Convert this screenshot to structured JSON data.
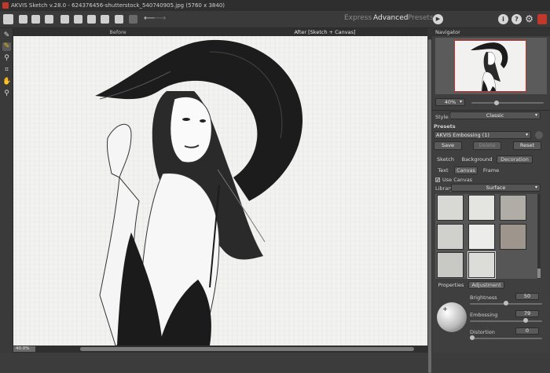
{
  "window": {
    "title": "AKVIS Sketch v.28.0 - 624376456-shutterstock_540740905.jpg (5760 x 3840)"
  },
  "toolbar": {
    "modes": [
      "Express",
      "Advanced",
      "Presets"
    ],
    "active_mode": "Advanced",
    "icons": [
      "home-icon",
      "open-icon",
      "save-icon",
      "print-icon",
      "batch-icon",
      "plugin-icon",
      "share-icon",
      "settings-icon",
      "apply-icon",
      "undo-icon",
      "redo-icon"
    ],
    "right_icons": [
      "info-icon",
      "help-icon",
      "gear-icon",
      "bookmark-icon"
    ]
  },
  "tools": [
    "pencil-icon",
    "eraser-icon",
    "stamp-icon",
    "crop-icon",
    "hand-icon",
    "zoom-icon"
  ],
  "canvas": {
    "before_label": "Before",
    "after_label": "After [Sketch + Canvas]",
    "zoom": "40.0%"
  },
  "navigator": {
    "title": "Navigator",
    "zoom": "40%"
  },
  "style": {
    "label": "Style:",
    "value": "Classic"
  },
  "presets": {
    "label": "Presets",
    "selected": "AKVIS Embossing (1)",
    "save": "Save",
    "delete": "Delete",
    "reset": "Reset"
  },
  "tabs": {
    "main": [
      "Sketch",
      "Background",
      "Decoration"
    ],
    "active_main": "Decoration",
    "sub": [
      "Text",
      "Canvas",
      "Frame"
    ],
    "active_sub": "Canvas"
  },
  "canvas_opts": {
    "use_canvas": "Use Canvas",
    "library_label": "Library",
    "library_value": "Surface"
  },
  "props": {
    "tabs": [
      "Properties",
      "Adjustment"
    ],
    "active": "Adjustment",
    "sliders": [
      {
        "label": "Brightness",
        "value": "50",
        "fraction": 0.5
      },
      {
        "label": "Embossing",
        "value": "79",
        "fraction": 0.79
      },
      {
        "label": "Distortion",
        "value": "0",
        "fraction": 0.0
      }
    ]
  },
  "colors": {
    "accent": "#c0392b",
    "panel": "#3f3f3f",
    "toolbar": "#3a3a3a"
  }
}
